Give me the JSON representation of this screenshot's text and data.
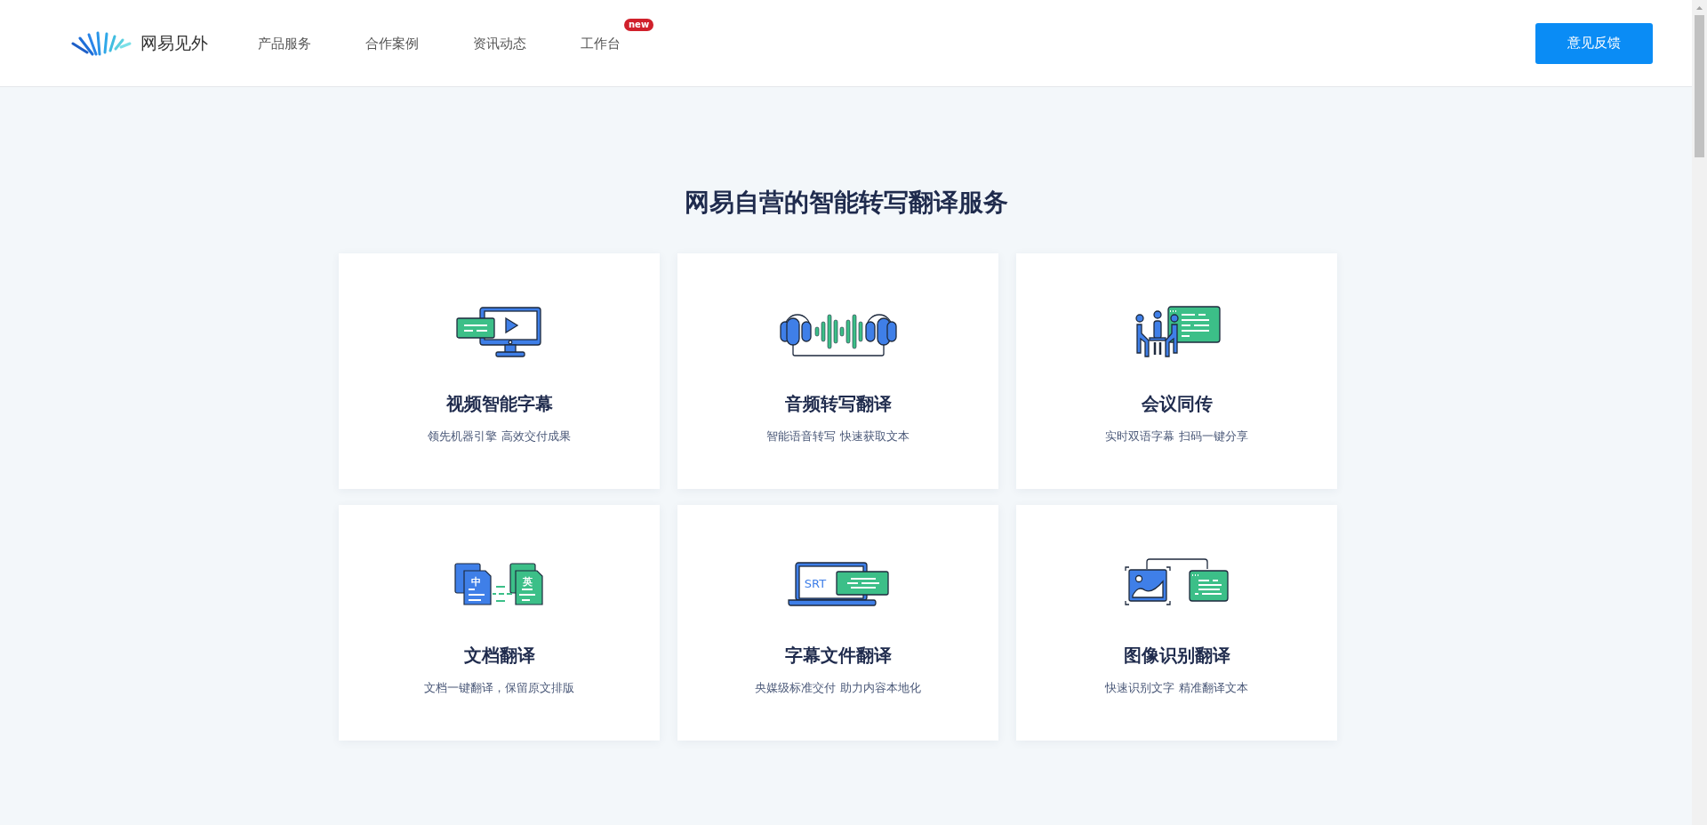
{
  "header": {
    "brand": "网易见外",
    "nav": [
      {
        "label": "产品服务"
      },
      {
        "label": "合作案例"
      },
      {
        "label": "资讯动态"
      },
      {
        "label": "工作台",
        "badge": "new"
      }
    ],
    "feedback_button": "意见反馈"
  },
  "section": {
    "title": "网易自营的智能转写翻译服务",
    "cards": [
      {
        "kind": "video",
        "title": "视频智能字幕",
        "subtitle": "领先机器引擎 高效交付成果"
      },
      {
        "kind": "audio",
        "title": "音频转写翻译",
        "subtitle": "智能语音转写 快速获取文本"
      },
      {
        "kind": "meeting",
        "title": "会议同传",
        "subtitle": "实时双语字幕 扫码一键分享"
      },
      {
        "kind": "document",
        "title": "文档翻译",
        "subtitle": "文档一键翻译，保留原文排版",
        "icon_labels": [
          "中",
          "英"
        ]
      },
      {
        "kind": "subtitle",
        "title": "字幕文件翻译",
        "subtitle": "央媒级标准交付 助力内容本地化",
        "icon_labels": [
          "SRT"
        ]
      },
      {
        "kind": "image",
        "title": "图像识别翻译",
        "subtitle": "快速识别文字 精准翻译文本"
      }
    ]
  }
}
